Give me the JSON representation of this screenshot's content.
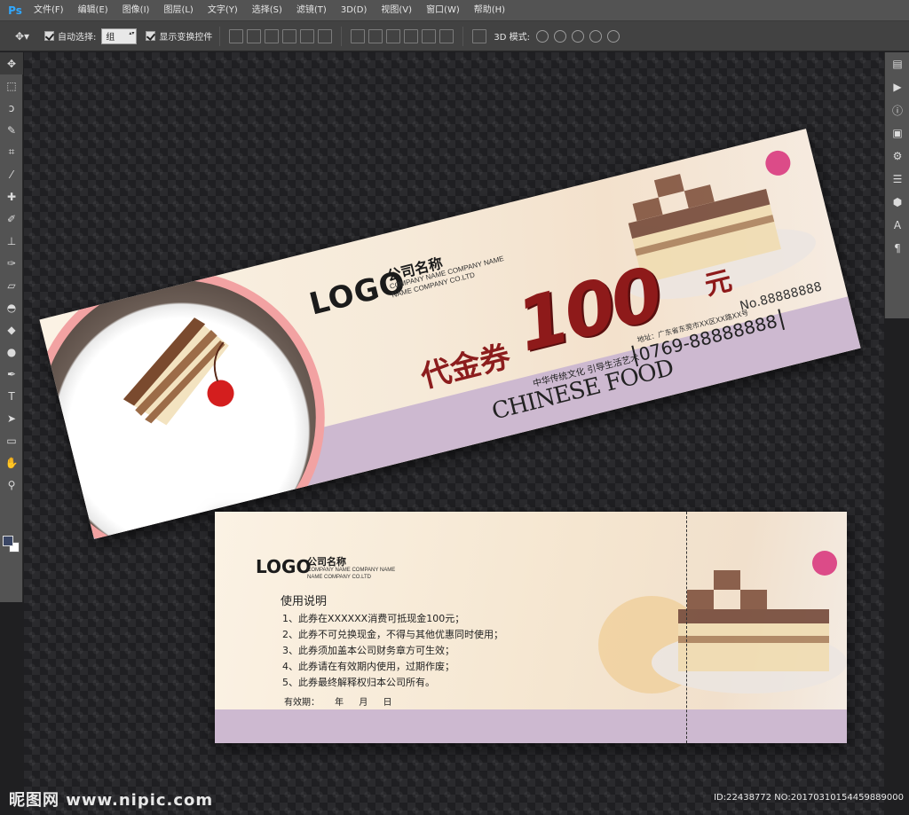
{
  "app": {
    "logo": "Ps"
  },
  "menu": [
    "文件(F)",
    "编辑(E)",
    "图像(I)",
    "图层(L)",
    "文字(Y)",
    "选择(S)",
    "滤镜(T)",
    "3D(D)",
    "视图(V)",
    "窗口(W)",
    "帮助(H)"
  ],
  "options": {
    "auto_select_label": "自动选择:",
    "auto_select_value": "组",
    "show_transform_label": "显示变换控件",
    "mode_3d_label": "3D 模式:"
  },
  "voucher_front": {
    "logo": "LOGO",
    "company_name": "公司名称",
    "company_en_1": "COMPANY NAME COMPANY NAME",
    "company_en_2": "NAME COMPANY CO.LTD",
    "voucher_label": "代金券",
    "amount": "100",
    "unit": "元",
    "slogan": "中华传统文化 引导生活艺术",
    "brand": "CHINESE FOOD",
    "address": "地址：广东省东莞市XX区XX路XX号",
    "phone": "0769-88888888",
    "number": "No.88888888"
  },
  "voucher_back": {
    "logo": "LOGO",
    "company_name": "公司名称",
    "company_en_1": "COMPANY NAME COMPANY NAME",
    "company_en_2": "NAME COMPANY CO.LTD",
    "heading": "使用说明",
    "rules": [
      "1、此券在XXXXXX消费可抵现金100元；",
      "2、此券不可兑换现金，不得与其他优惠同时使用；",
      "3、此券须加盖本公司财务章方可生效；",
      "4、此券请在有效期内使用，过期作废；",
      "5、此券最终解释权归本公司所有。"
    ],
    "validity": "有效期：   年  月  日"
  },
  "watermark": {
    "site": "昵图网 www.nipic.com",
    "id": "ID:22438772 NO:20170310154459889000"
  },
  "colors": {
    "amount_red": "#8e1a1a",
    "band_lavender": "#cdb9d0",
    "ps_blue": "#31a8ff"
  }
}
